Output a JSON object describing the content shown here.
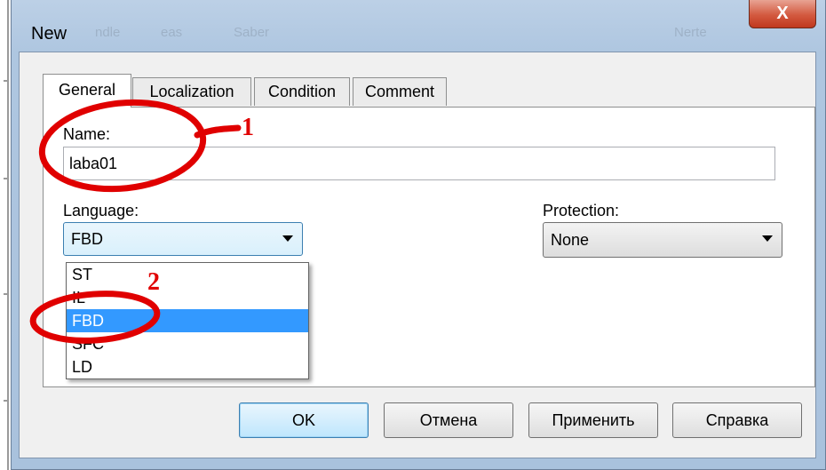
{
  "dialog": {
    "title": "New",
    "close_glyph": "X",
    "ghost_text": [
      "ndle",
      "eas",
      "Saber",
      "Nerte"
    ]
  },
  "tabs": [
    {
      "label": "General",
      "active": true
    },
    {
      "label": "Localization",
      "active": false
    },
    {
      "label": "Condition",
      "active": false
    },
    {
      "label": "Comment",
      "active": false
    }
  ],
  "general": {
    "name_label": "Name:",
    "name_value": "laba01",
    "language_label": "Language:",
    "language_value": "FBD",
    "language_options": [
      "ST",
      "IL",
      "FBD",
      "SFC",
      "LD"
    ],
    "language_selected_index": 2,
    "protection_label": "Protection:",
    "protection_value": "None"
  },
  "buttons": {
    "ok": "OK",
    "cancel": "Отмена",
    "apply": "Применить",
    "help": "Справка"
  },
  "annotations": {
    "marker_1": "1",
    "marker_2": "2",
    "color": "#e00000"
  }
}
